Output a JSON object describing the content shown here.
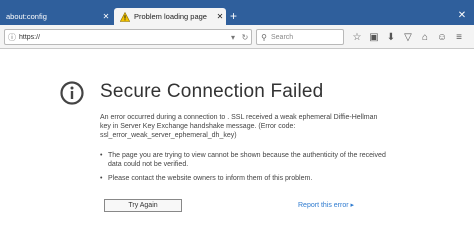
{
  "tabs": [
    {
      "title": "about:config",
      "active": false,
      "close": "✕"
    },
    {
      "title": "Problem loading page",
      "active": true,
      "close": "✕"
    }
  ],
  "newtab_label": "+",
  "window": {
    "close": "✕"
  },
  "nav": {
    "url": "https://",
    "search_placeholder": "Search",
    "icons": [
      "star-icon",
      "clipboard-icon",
      "download-icon",
      "pocket-icon",
      "home-icon",
      "smiley-icon",
      "menu-icon"
    ],
    "glyphs": {
      "star": "☆",
      "clipboard": "▣",
      "download": "⬇",
      "pocket": "▽",
      "home": "⌂",
      "smiley": "☺",
      "menu": "≡"
    }
  },
  "error": {
    "title": "Secure Connection Failed",
    "description": "An error occurred during a connection to                          . SSL received a weak ephemeral Diffie-Hellman key in Server Key Exchange handshake message. (Error code: ssl_error_weak_server_ephemeral_dh_key)",
    "bullets": [
      "The page you are trying to view cannot be shown because the authenticity of the received data could not be verified.",
      "Please contact the website owners to inform them of this problem."
    ],
    "try_again": "Try Again",
    "report": "Report this error ▸"
  }
}
